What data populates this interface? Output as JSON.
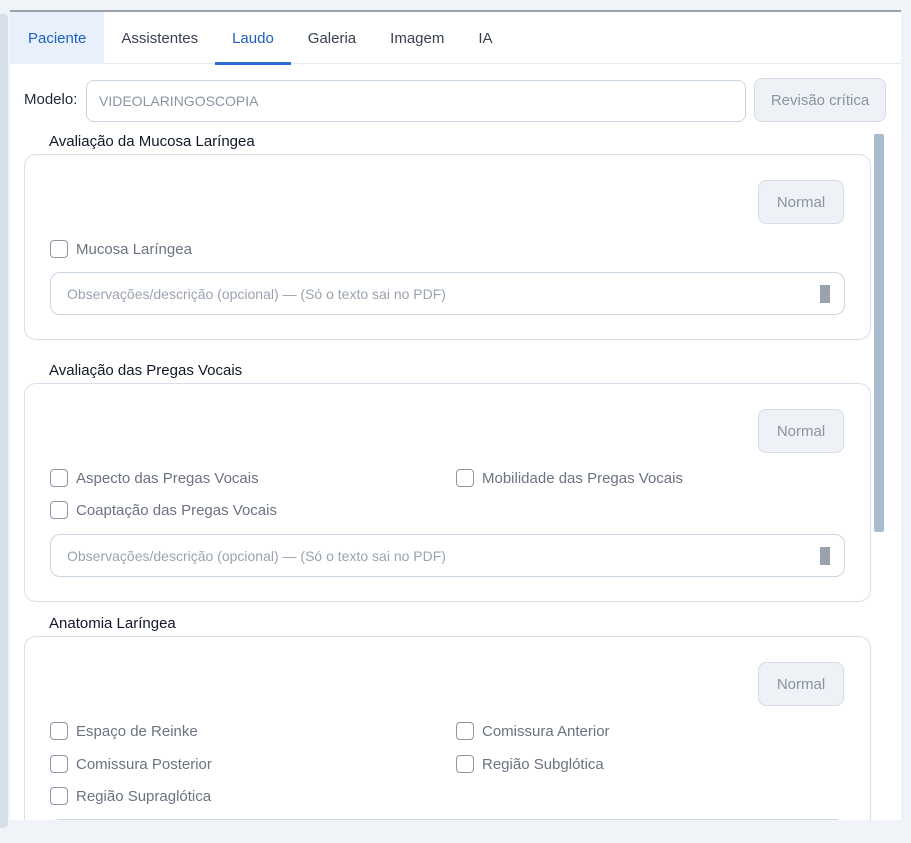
{
  "tabs": [
    {
      "label": "Paciente"
    },
    {
      "label": "Assistentes"
    },
    {
      "label": "Laudo"
    },
    {
      "label": "Galeria"
    },
    {
      "label": "Imagem"
    },
    {
      "label": "IA"
    }
  ],
  "active_tab": "Laudo",
  "model": {
    "label": "Modelo:",
    "value": "VIDEOLARINGOSCOPIA",
    "review_button": "Revisão crítica"
  },
  "sections": [
    {
      "title": "Avaliação da Mucosa Laríngea",
      "normal_button": "Normal",
      "items": [
        "Mucosa Laríngea"
      ],
      "observation_placeholder": "Observações/descrição (opcional) — (Só o texto sai no PDF)"
    },
    {
      "title": "Avaliação das Pregas Vocais",
      "normal_button": "Normal",
      "items": [
        "Aspecto das Pregas Vocais",
        "Mobilidade das Pregas Vocais",
        "Coaptação das Pregas Vocais"
      ],
      "observation_placeholder": "Observações/descrição (opcional) — (Só o texto sai no PDF)"
    },
    {
      "title": "Anatomia Laríngea",
      "normal_button": "Normal",
      "items": [
        "Espaço de Reinke",
        "Comissura Anterior",
        "Comissura Posterior",
        "Região Subglótica",
        "Região Supraglótica"
      ]
    }
  ]
}
